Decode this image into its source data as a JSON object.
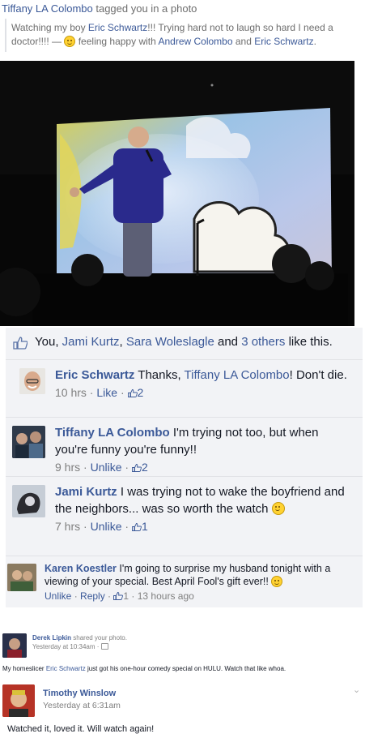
{
  "header": {
    "actor": "Tiffany LA Colombo",
    "action": "tagged you in a photo",
    "status_prefix": "Watching my boy ",
    "status_person": "Eric Schwartz",
    "status_suffix": "!!! Trying hard not to laugh so hard I need a doctor!!!! —",
    "feeling": "feeling happy with",
    "with_1": "Andrew Colombo",
    "and": "and",
    "with_2": "Eric Schwartz",
    "end": "."
  },
  "likes": {
    "you": "You,",
    "person_1": "Jami Kurtz",
    "comma": ",",
    "person_2": "Sara Woleslagle",
    "and": "and",
    "others": "3 others",
    "suffix": "like this."
  },
  "comments": [
    {
      "name": "Eric Schwartz",
      "text_1": "Thanks,",
      "mention": "Tiffany LA Colombo",
      "text_2": "! Don't die.",
      "time": "10 hrs",
      "action": "Like",
      "likes": "2"
    },
    {
      "name": "Tiffany LA Colombo",
      "text": "I'm trying not too, but when you're funny you're funny!!",
      "time": "9 hrs",
      "action": "Unlike",
      "likes": "2"
    },
    {
      "name": "Jami Kurtz",
      "text": "I was trying not to wake the boyfriend and the neighbors... was so worth the watch",
      "time": "7 hrs",
      "action": "Unlike",
      "likes": "1"
    },
    {
      "name": "Karen Koestler",
      "text": "I'm going to surprise my husband tonight with a viewing of your special. Best April Fool's gift ever!!",
      "action_1": "Unlike",
      "action_2": "Reply",
      "likes": "1",
      "time": "13 hours ago"
    }
  ],
  "share_post": {
    "name": "Derek Lipkin",
    "action": "shared your photo.",
    "time": "Yesterday at 10:34am",
    "text_1": "My homeslicer",
    "mention": "Eric Schwartz",
    "text_2": "just got his one-hour comedy special on HULU. Watch that like whoa."
  },
  "timothy_post": {
    "name": "Timothy Winslow",
    "time": "Yesterday at 6:31am",
    "text": "Watched it, loved it. Will watch again!"
  },
  "colors": {
    "link": "#3b5998",
    "ufi_bg": "#f2f3f6"
  }
}
